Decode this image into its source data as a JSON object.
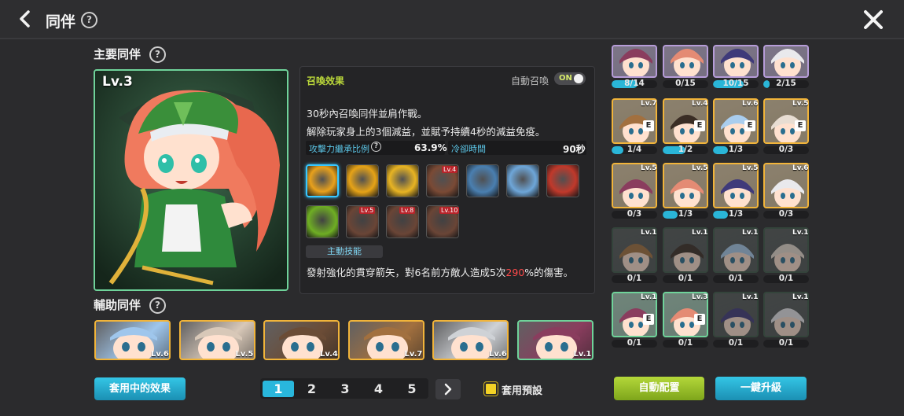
{
  "header": {
    "title": "同伴",
    "help": "?"
  },
  "main_section": {
    "title": "主要同伴",
    "help": "?",
    "level": "Lv.3"
  },
  "panel": {
    "summon_label": "召喚效果",
    "auto_summon_label": "自動召喚",
    "toggle_state": "ON",
    "desc_line1": "30秒內召喚同伴並肩作戰。",
    "desc_line2": "解除玩家身上的3個減益，並賦予持續4秒的減益免疫。",
    "stat_attack_label": "攻擊力繼承比例",
    "stat_attack_help": "?",
    "stat_attack_value": "63.9%",
    "stat_cooldown_label": "冷卻時間",
    "stat_cooldown_value": "90秒",
    "active_skill_label": "主動技能",
    "active_desc_pre": "發射強化的貫穿箭矢，對6名前方敵人造成5次",
    "active_desc_pct": "290",
    "active_desc_post": "%的傷害。",
    "skills_row1": [
      {
        "icon": "gold-cross-skill-icon",
        "lv": "",
        "selected": true,
        "color": "#e8a11c"
      },
      {
        "icon": "gold-swirl-skill-icon",
        "lv": "",
        "selected": false,
        "color": "#e6a317"
      },
      {
        "icon": "gold-burst-skill-icon",
        "lv": "",
        "selected": false,
        "color": "#e8b423"
      },
      {
        "icon": "bronze-emblem-skill-icon",
        "lv": "Lv.4",
        "selected": false,
        "color": "#7a4a35"
      },
      {
        "icon": "fist-impact-skill-icon",
        "lv": "",
        "selected": false,
        "color": "#4a7fb0"
      },
      {
        "icon": "summon-gate-skill-icon",
        "lv": "",
        "selected": false,
        "color": "#6ea6d8"
      },
      {
        "icon": "heal-shield-skill-icon",
        "lv": "",
        "selected": false,
        "color": "#c0392b"
      }
    ],
    "skills_row2": [
      {
        "icon": "green-arrow-skill-icon",
        "lv": "",
        "color": "#6fae24"
      },
      {
        "icon": "bow-skill-icon",
        "lv": "Lv.5",
        "color": "#6a4536"
      },
      {
        "icon": "bow-skill-icon",
        "lv": "Lv.8",
        "color": "#6a4536"
      },
      {
        "icon": "bow-skill-icon",
        "lv": "Lv.10",
        "color": "#6a4536"
      }
    ]
  },
  "support_section": {
    "title": "輔助同伴",
    "help": "?",
    "members": [
      {
        "name": "support-blue-hair-girl",
        "lv": "Lv.6",
        "color": "#9fc6ec",
        "border": "#f1b43a"
      },
      {
        "name": "support-white-hair-warrior",
        "lv": "Lv.5",
        "color": "#d8c8b8",
        "border": "#f1b43a"
      },
      {
        "name": "support-dark-hair-fighter",
        "lv": "Lv.4",
        "color": "#6b4c36",
        "border": "#f1b43a"
      },
      {
        "name": "support-brown-hair-boy",
        "lv": "Lv.7",
        "color": "#a2703f",
        "border": "#f1b43a"
      },
      {
        "name": "support-masked-ninja",
        "lv": "Lv.6",
        "color": "#cfd2d6",
        "border": "#f1b43a"
      },
      {
        "name": "support-purple-hair-girl",
        "lv": "Lv.1",
        "color": "#8a3d5e",
        "border": "#6fd39a"
      }
    ]
  },
  "footer": {
    "active_effect_btn": "套用中的效果",
    "pages": [
      "1",
      "2",
      "3",
      "4",
      "5"
    ],
    "next": "›",
    "apply_preset": "套用預設",
    "auto_config_btn": "自動配置",
    "upgrade_all_btn": "一鍵升級"
  },
  "grid": [
    [
      {
        "lv": "",
        "e": false,
        "progress": "8/14",
        "fill": 0.57,
        "tier": "purple",
        "color": "#8a3d5e"
      },
      {
        "lv": "",
        "e": false,
        "progress": "0/15",
        "fill": 0,
        "tier": "purple",
        "color": "#e48b74"
      },
      {
        "lv": "",
        "e": false,
        "progress": "10/15",
        "fill": 0.67,
        "tier": "purple",
        "color": "#3f3a7a"
      },
      {
        "lv": "",
        "e": false,
        "progress": "2/15",
        "fill": 0.13,
        "tier": "purple",
        "color": "#e9e9ec"
      }
    ],
    [
      {
        "lv": "Lv.7",
        "e": true,
        "progress": "1/4",
        "fill": 0.25,
        "tier": "gold",
        "color": "#a2703f"
      },
      {
        "lv": "Lv.4",
        "e": true,
        "progress": "1/2",
        "fill": 0.5,
        "tier": "gold",
        "color": "#3a2d24"
      },
      {
        "lv": "Lv.6",
        "e": true,
        "progress": "1/3",
        "fill": 0.33,
        "tier": "gold",
        "color": "#a9cdee"
      },
      {
        "lv": "Lv.5",
        "e": true,
        "progress": "0/3",
        "fill": 0,
        "tier": "gold",
        "color": "#e8ddd2"
      }
    ],
    [
      {
        "lv": "Lv.5",
        "e": false,
        "progress": "0/3",
        "fill": 0,
        "tier": "gold",
        "color": "#8a3d5e"
      },
      {
        "lv": "Lv.5",
        "e": false,
        "progress": "1/3",
        "fill": 0.33,
        "tier": "gold",
        "color": "#e48b74"
      },
      {
        "lv": "Lv.5",
        "e": false,
        "progress": "1/3",
        "fill": 0.33,
        "tier": "gold",
        "color": "#3f3a7a"
      },
      {
        "lv": "Lv.6",
        "e": false,
        "progress": "0/3",
        "fill": 0,
        "tier": "gold",
        "color": "#e9e9ec"
      }
    ],
    [
      {
        "lv": "Lv.1",
        "e": false,
        "progress": "0/1",
        "fill": 0,
        "tier": "dim",
        "color": "#a2703f"
      },
      {
        "lv": "Lv.1",
        "e": false,
        "progress": "0/1",
        "fill": 0,
        "tier": "dim",
        "color": "#3a2d24"
      },
      {
        "lv": "Lv.1",
        "e": false,
        "progress": "0/1",
        "fill": 0,
        "tier": "dim",
        "color": "#a9cdee"
      },
      {
        "lv": "Lv.1",
        "e": false,
        "progress": "0/1",
        "fill": 0,
        "tier": "dim",
        "color": "#e8ddd2"
      }
    ],
    [
      {
        "lv": "Lv.1",
        "e": true,
        "progress": "0/1",
        "fill": 0,
        "tier": "green",
        "color": "#8a3d5e"
      },
      {
        "lv": "Lv.3",
        "e": true,
        "progress": "0/1",
        "fill": 0,
        "tier": "green",
        "color": "#e48b74"
      },
      {
        "lv": "Lv.1",
        "e": false,
        "progress": "0/1",
        "fill": 0,
        "tier": "dim",
        "color": "#3f3a7a"
      },
      {
        "lv": "Lv.1",
        "e": false,
        "progress": "0/1",
        "fill": 0,
        "tier": "dim",
        "color": "#e9e9ec"
      }
    ]
  ],
  "colors": {
    "accent_cyan": "#29b7dc",
    "accent_green": "#9cc52a",
    "highlight_red": "#ff4a4a"
  }
}
